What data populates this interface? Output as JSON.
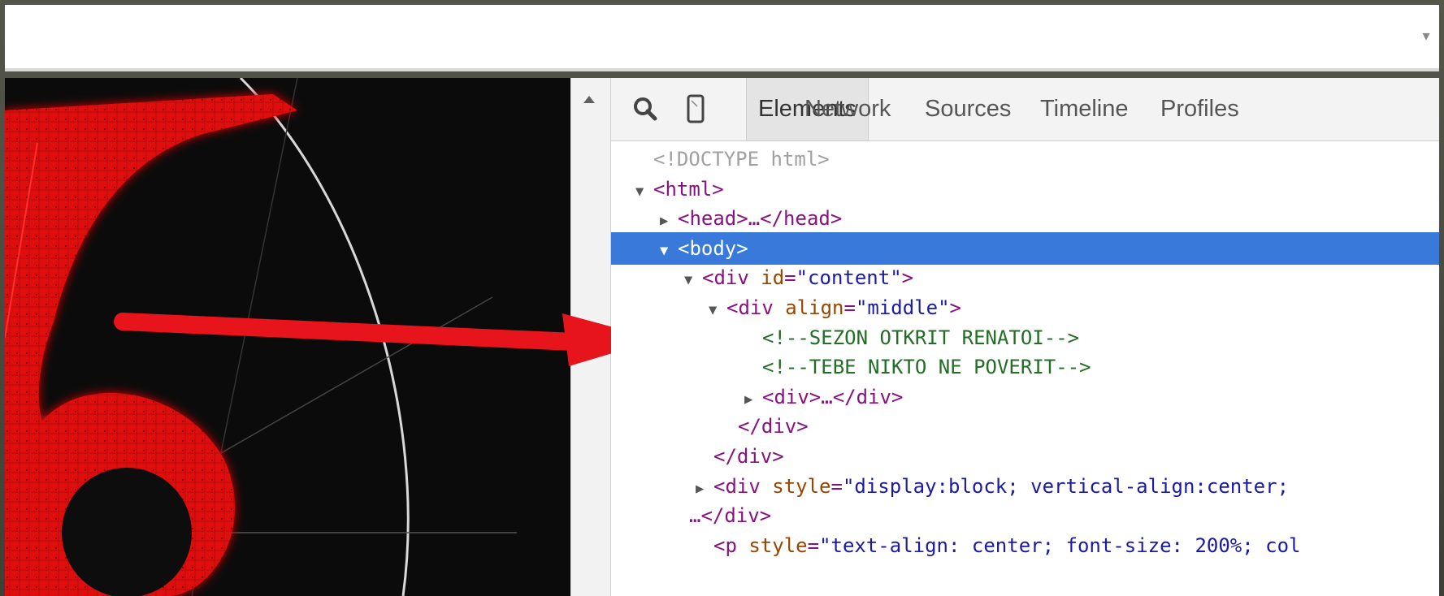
{
  "devtools": {
    "tabs": [
      "Elements",
      "Network",
      "Sources",
      "Timeline",
      "Profiles"
    ],
    "active_tab": "Elements",
    "icons": [
      "search-icon",
      "device-mode-icon"
    ],
    "lines": [
      {
        "indent": 0,
        "arrow": "",
        "parts": [
          [
            "doctype",
            "<!DOCTYPE html>"
          ]
        ]
      },
      {
        "indent": 0,
        "arrow": "▼",
        "parts": [
          [
            "tag",
            "<html>"
          ]
        ]
      },
      {
        "indent": 1,
        "arrow": "▶",
        "parts": [
          [
            "tag",
            "<head>…</head>"
          ]
        ]
      },
      {
        "indent": 1,
        "arrow": "▼",
        "parts": [
          [
            "tag",
            "<body>"
          ]
        ],
        "selected": true
      },
      {
        "indent": 2,
        "arrow": "▼",
        "parts": [
          [
            "tag",
            "<div "
          ],
          [
            "attr-n",
            "id"
          ],
          [
            "tag",
            "="
          ],
          [
            "attr-v",
            "\"content\""
          ],
          [
            "tag",
            ">"
          ]
        ]
      },
      {
        "indent": 3,
        "arrow": "▼",
        "parts": [
          [
            "tag",
            "<div "
          ],
          [
            "attr-n",
            "align"
          ],
          [
            "tag",
            "="
          ],
          [
            "attr-v",
            "\"middle\""
          ],
          [
            "tag",
            ">"
          ]
        ]
      },
      {
        "indent": 4,
        "arrow": "",
        "parts": [
          [
            "comment",
            "<!--SEZON OTKRIT RENATOI-->"
          ]
        ]
      },
      {
        "indent": 4,
        "arrow": "",
        "parts": [
          [
            "comment",
            "<!--TEBE NIKTO NE POVERIT-->"
          ]
        ]
      },
      {
        "indent": 4,
        "arrow": "▶",
        "parts": [
          [
            "tag",
            "<div>…</div>"
          ]
        ]
      },
      {
        "indent": 3,
        "arrow": "",
        "parts": [
          [
            "tag",
            "</div>"
          ]
        ]
      },
      {
        "indent": 2,
        "arrow": "",
        "parts": [
          [
            "tag",
            "</div>"
          ]
        ]
      },
      {
        "indent": 2,
        "arrow": "▶",
        "parts": [
          [
            "tag",
            "<div "
          ],
          [
            "attr-n",
            "style"
          ],
          [
            "tag",
            "="
          ],
          [
            "attr-v",
            "\"display:block; vertical-align:center;"
          ]
        ]
      },
      {
        "indent": 1,
        "arrow": "",
        "parts": [
          [
            "tag",
            "…</div>"
          ]
        ]
      },
      {
        "indent": 2,
        "arrow": "",
        "parts": [
          [
            "tag",
            "<p "
          ],
          [
            "attr-n",
            "style"
          ],
          [
            "tag",
            "="
          ],
          [
            "attr-v",
            "\"text-align: center; font-size: 200%; col"
          ]
        ]
      }
    ]
  },
  "colors": {
    "selection": "#3879d9",
    "tag": "#881280",
    "comment": "#236e25",
    "arrow": "#e8141b",
    "logo": "#e01010"
  }
}
